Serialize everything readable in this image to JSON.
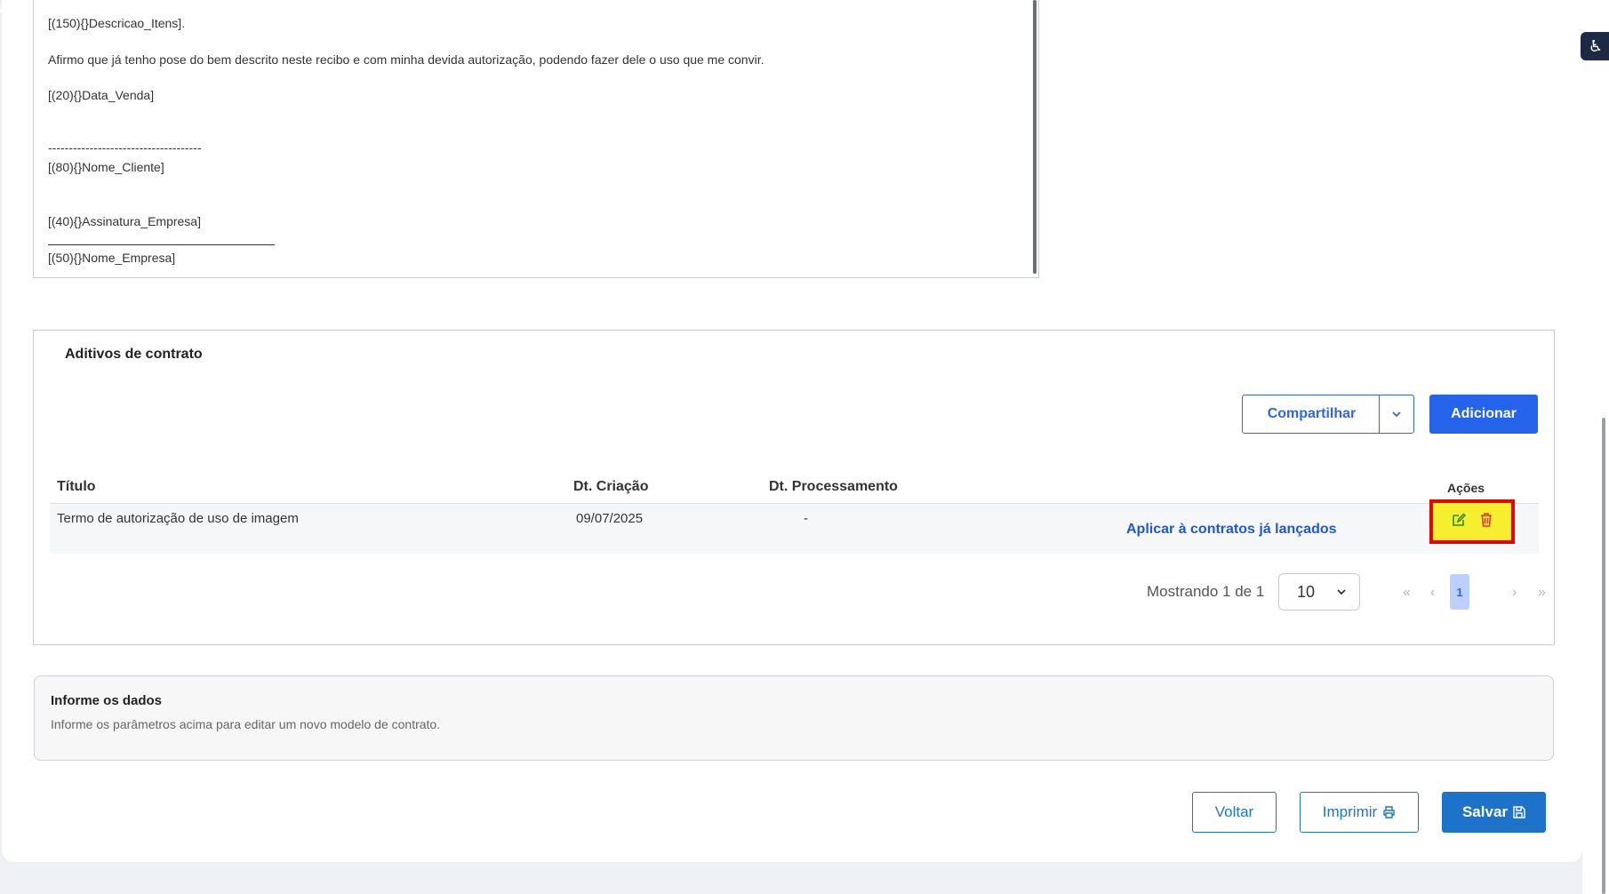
{
  "editor": {
    "lines": [
      "[(150){}Descricao_Itens].",
      "Afirmo que já tenho pose do bem descrito neste recibo e com minha devida autorização, podendo fazer dele o uso que me convir.",
      "[(20){}Data_Venda]",
      "-------------------------------------",
      "[(80){}Nome_Cliente]",
      "[(40){}Assinatura_Empresa]",
      "[(50){}Nome_Empresa]"
    ]
  },
  "aditivos": {
    "title": "Aditivos de contrato",
    "share_label": "Compartilhar",
    "add_label": "Adicionar",
    "columns": {
      "titulo": "Título",
      "criacao": "Dt. Criação",
      "processamento": "Dt. Processamento",
      "acoes": "Ações"
    },
    "rows": [
      {
        "titulo": "Termo de autorização de uso de imagem",
        "criacao": "09/07/2025",
        "processamento": "-",
        "link": "Aplicar à contratos já lançados"
      }
    ],
    "pager": {
      "showing": "Mostrando 1 de 1",
      "page_size": "10",
      "first": "«",
      "prev": "‹",
      "current": "1",
      "next": "›",
      "last": "»"
    }
  },
  "info": {
    "title": "Informe os dados",
    "description": "Informe os parâmetros acima para editar um novo modelo de contrato."
  },
  "footer": {
    "back_label": "Voltar",
    "print_label": "Imprimir",
    "save_label": "Salvar"
  },
  "colors": {
    "primary": "#2563eb",
    "highlight_border": "#e10600",
    "highlight_fill": "#f5ef30"
  }
}
